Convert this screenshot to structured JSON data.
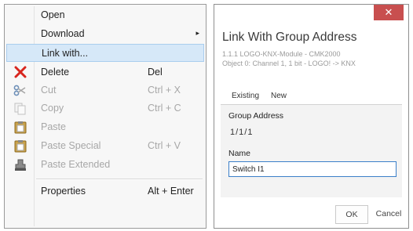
{
  "context_menu": {
    "items": [
      {
        "label": "Open",
        "shortcut": "",
        "icon": "",
        "disabled": false
      },
      {
        "label": "Download",
        "shortcut": "",
        "icon": "",
        "disabled": false,
        "submenu": true
      },
      {
        "label": "Link with...",
        "shortcut": "",
        "icon": "",
        "disabled": false,
        "highlighted": true
      },
      {
        "label": "Delete",
        "shortcut": "Del",
        "icon": "delete-x-icon",
        "disabled": false
      },
      {
        "label": "Cut",
        "shortcut": "Ctrl + X",
        "icon": "scissors-icon",
        "disabled": true
      },
      {
        "label": "Copy",
        "shortcut": "Ctrl + C",
        "icon": "copy-icon",
        "disabled": true
      },
      {
        "label": "Paste",
        "shortcut": "",
        "icon": "clipboard-icon",
        "disabled": true
      },
      {
        "label": "Paste Special",
        "shortcut": "Ctrl + V",
        "icon": "clipboard-icon",
        "disabled": true
      },
      {
        "label": "Paste Extended",
        "shortcut": "",
        "icon": "stamp-icon",
        "disabled": true
      },
      {
        "label": "Properties",
        "shortcut": "Alt + Enter",
        "icon": "",
        "disabled": false
      }
    ],
    "submenu_arrow": "▸"
  },
  "dialog": {
    "close_glyph": "✕",
    "title": "Link With Group Address",
    "subtitle_1": "1.1.1 LOGO-KNX-Module - CMK2000",
    "subtitle_2": "Object 0: Channel 1, 1 bit - LOGO! -> KNX",
    "tabs": [
      "Existing",
      "New"
    ],
    "group_address_label": "Group Address",
    "group_address_value": "1/1/1",
    "name_label": "Name",
    "name_value": "Switch I1",
    "ok_label": "OK",
    "cancel_label": "Cancel",
    "close_color": "#c84f4f",
    "input_focus_color": "#3b7fc9"
  }
}
